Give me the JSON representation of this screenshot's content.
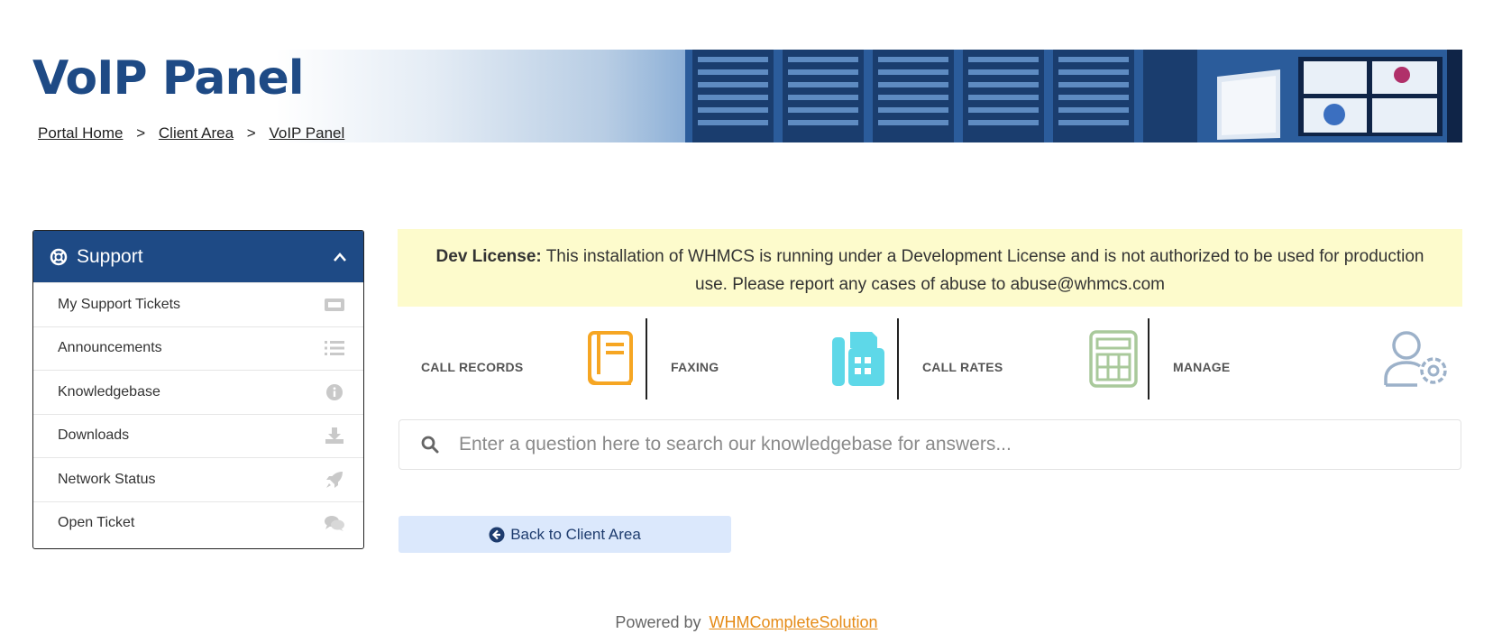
{
  "header": {
    "title": "VoIP Panel",
    "breadcrumb": [
      {
        "label": "Portal Home"
      },
      {
        "label": "Client Area"
      },
      {
        "label": "VoIP Panel"
      }
    ],
    "separator": ">"
  },
  "sidebar": {
    "title": "Support",
    "header_icon": "lifebuoy-icon",
    "collapse_icon": "chevron-up-icon",
    "items": [
      {
        "label": "My Support Tickets",
        "icon": "ticket-icon"
      },
      {
        "label": "Announcements",
        "icon": "list-icon"
      },
      {
        "label": "Knowledgebase",
        "icon": "info-circle-icon"
      },
      {
        "label": "Downloads",
        "icon": "download-icon"
      },
      {
        "label": "Network Status",
        "icon": "rocket-icon"
      },
      {
        "label": "Open Ticket",
        "icon": "comments-icon"
      }
    ]
  },
  "license": {
    "bold": "Dev License:",
    "text": "This installation of WHMCS is running under a Development License and is not authorized to be used for production use. Please report any cases of abuse to abuse@whmcs.com"
  },
  "tiles": [
    {
      "label": "CALL RECORDS",
      "icon": "book-icon",
      "color": "#f6a623"
    },
    {
      "label": "FAXING",
      "icon": "fax-icon",
      "color": "#5ed8e8"
    },
    {
      "label": "CALL RATES",
      "icon": "calculator-icon",
      "color": "#a9c99b"
    },
    {
      "label": "MANAGE",
      "icon": "user-gear-icon",
      "color": "#9cb1c9"
    }
  ],
  "search": {
    "placeholder": "Enter a question here to search our knowledgebase for answers...",
    "icon": "search-icon"
  },
  "back_button": {
    "label": "Back to Client Area",
    "icon": "arrow-circle-left-icon"
  },
  "footer": {
    "prefix": "Powered by",
    "link": "WHMCompleteSolution"
  },
  "colors": {
    "brand": "#1e4a85",
    "license_bg": "#fdfbcc",
    "button_bg": "#dbe8fc",
    "link_orange": "#e58b17"
  }
}
